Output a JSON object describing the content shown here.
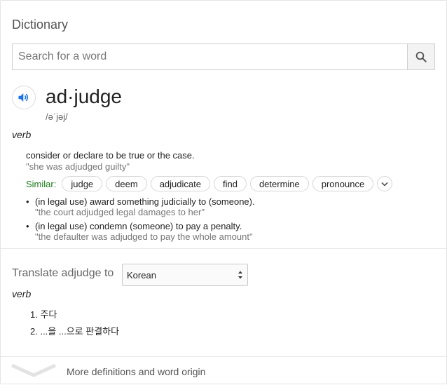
{
  "app": {
    "title": "Dictionary"
  },
  "search": {
    "placeholder": "Search for a word",
    "value": ""
  },
  "entry": {
    "headword": "ad·judge",
    "phonetic": "/əˈjəj/",
    "pos": "verb",
    "definition": "consider or declare to be true or the case.",
    "example": "\"she was adjudged guilty\"",
    "similar_label": "Similar:",
    "similar": [
      "judge",
      "deem",
      "adjudicate",
      "find",
      "determine",
      "pronounce"
    ],
    "subdefinitions": [
      {
        "text": "(in legal use) award something judicially to (someone).",
        "example": "\"the court adjudged legal damages to her\""
      },
      {
        "text": "(in legal use) condemn (someone) to pay a penalty.",
        "example": "\"the defaulter was adjudged to pay the whole amount\""
      }
    ]
  },
  "translate": {
    "label": "Translate adjudge to",
    "language": "Korean",
    "pos": "verb",
    "items": [
      "1. 주다",
      "2. ...을 ...으로 판결하다"
    ]
  },
  "footer": {
    "more_label": "More definitions and word origin"
  },
  "colors": {
    "accent": "#1a73e8",
    "similar_label": "#1e7a1e",
    "example": "#767676"
  }
}
